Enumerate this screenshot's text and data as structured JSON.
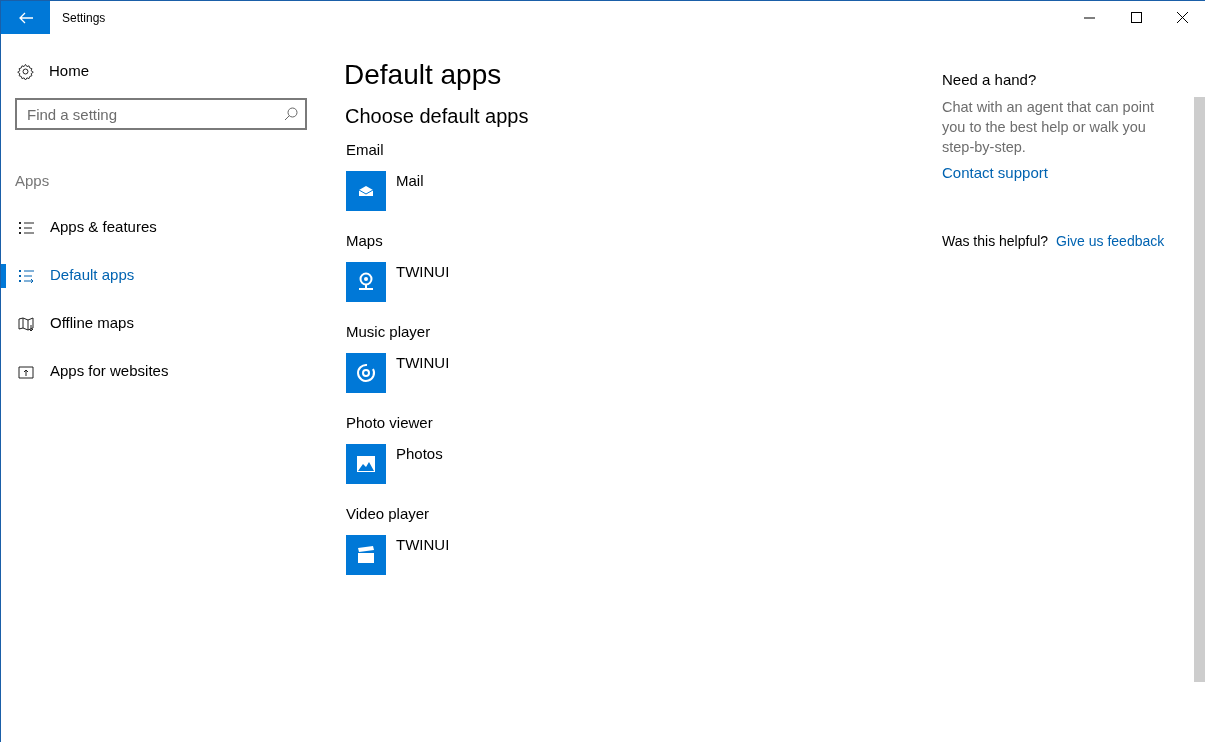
{
  "window": {
    "title": "Settings"
  },
  "sidebar": {
    "home": "Home",
    "search": {
      "placeholder": "Find a setting"
    },
    "section": "Apps",
    "items": [
      {
        "label": "Apps & features",
        "selected": false
      },
      {
        "label": "Default apps",
        "selected": true
      },
      {
        "label": "Offline maps",
        "selected": false
      },
      {
        "label": "Apps for websites",
        "selected": false
      }
    ]
  },
  "page": {
    "title": "Default apps",
    "subtitle": "Choose default apps",
    "defaults": [
      {
        "category": "Email",
        "app": "Mail",
        "kind": "mail"
      },
      {
        "category": "Maps",
        "app": "TWINUI",
        "kind": "maps"
      },
      {
        "category": "Music player",
        "app": "TWINUI",
        "kind": "music"
      },
      {
        "category": "Photo viewer",
        "app": "Photos",
        "kind": "photos"
      },
      {
        "category": "Video player",
        "app": "TWINUI",
        "kind": "video"
      }
    ]
  },
  "help": {
    "title": "Need a hand?",
    "text": "Chat with an agent that can point you to the best help or walk you step-by-step.",
    "link": "Contact support",
    "question": "Was this helpful?",
    "feedback": "Give us feedback"
  }
}
